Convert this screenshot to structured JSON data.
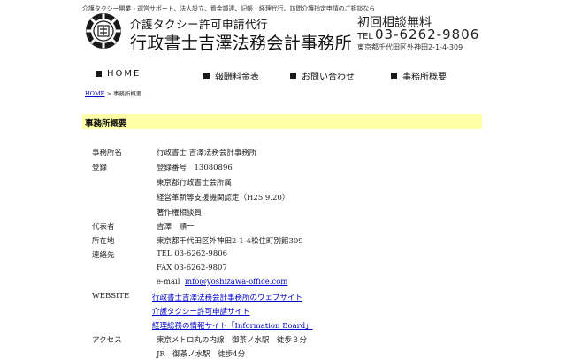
{
  "header": {
    "top_strip": "介護タクシー開業・運営サポート、法人設立、資金調達、記帳・経理代行、訪問介護指定申請のご相談なら",
    "subtitle": "介護タクシー許可申請代行",
    "title": "行政書士吉澤法務会計事務所",
    "consult": "初回相談無料",
    "tel_prefix": "TEL",
    "phone": "03-6262-9806",
    "address": "東京都千代田区外神田2-1-4-309"
  },
  "nav": {
    "items": [
      {
        "label": "HOME"
      },
      {
        "label": "報酬料金表"
      },
      {
        "label": "お問い合わせ"
      },
      {
        "label": "事務所概要"
      }
    ]
  },
  "breadcrumb": {
    "home": "HOME",
    "sep": ">",
    "current": "事務所概要"
  },
  "section": {
    "title": "事務所概要"
  },
  "profile": {
    "rows": [
      {
        "label": "事務所名",
        "values": [
          "行政書士 吉澤法務会計事務所"
        ]
      },
      {
        "label": "登録",
        "values": [
          "登録番号　13080896",
          "東京都行政書士会所属",
          "経営革新等支援機関認定（H25.9.20）",
          "著作権相談員"
        ]
      },
      {
        "label": "代表者",
        "values": [
          "吉澤　順一"
        ]
      },
      {
        "label": "所在地",
        "values": [
          "東京都千代田区外神田2-1-4松住町別館309"
        ]
      },
      {
        "label": "連絡先",
        "values": [
          "TEL  03-6262-9806",
          "FAX  03-6262-9807"
        ]
      },
      {
        "label": "",
        "email_prefix": "e-mail",
        "email": "info@yoshizawa-office.com"
      },
      {
        "label": "WEBSITE",
        "links": [
          "行政書士吉澤法務会計事務所のウェブサイト",
          "介護タクシー許可申請サイト",
          "経理総務の情報サイト「Information Board」"
        ]
      },
      {
        "label": "アクセス",
        "values": [
          "東京メトロ丸の内線　御茶ノ水駅　徒歩３分",
          "JR　御茶ノ水駅　徒歩4分"
        ]
      }
    ]
  }
}
